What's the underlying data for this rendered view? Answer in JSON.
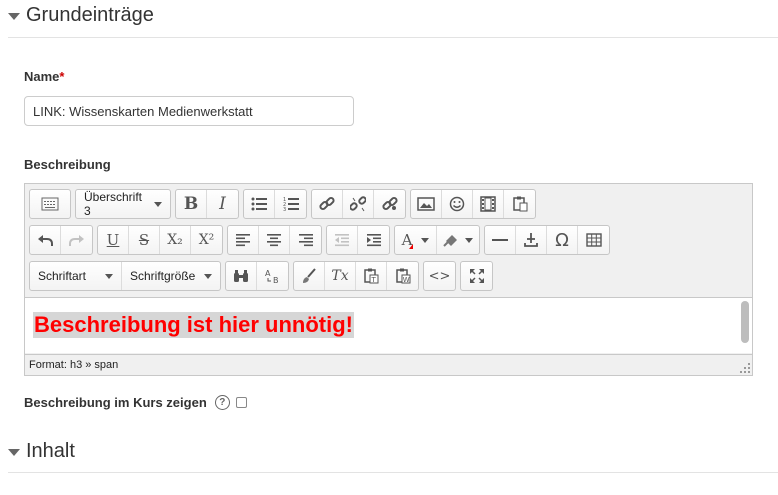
{
  "sections": {
    "general": "Grundeinträge",
    "content": "Inhalt"
  },
  "name_field": {
    "label": "Name",
    "required_mark": "*",
    "value": "LINK: Wissenskarten Medienwerkstatt"
  },
  "description": {
    "label": "Beschreibung",
    "toolbar": {
      "heading_select": "Überschrift 3",
      "font_select": "Schriftart",
      "size_select": "Schriftgröße",
      "bold": "B",
      "italic": "I",
      "underline": "U",
      "strike": "S",
      "subscript": "X₂",
      "superscript": "X²",
      "font_color": "A",
      "special_char": "Ω",
      "code": "<>",
      "clear_format": "Tx"
    },
    "content_text": "Beschreibung ist hier unnötig!",
    "status_path": "Format: h3 » span"
  },
  "show_in_course": {
    "label": "Beschreibung im Kurs zeigen",
    "help": "?",
    "checked": false
  },
  "colors": {
    "content_text": "#ff0000",
    "highlight": "#d6d6d6",
    "required": "#cc0000"
  }
}
